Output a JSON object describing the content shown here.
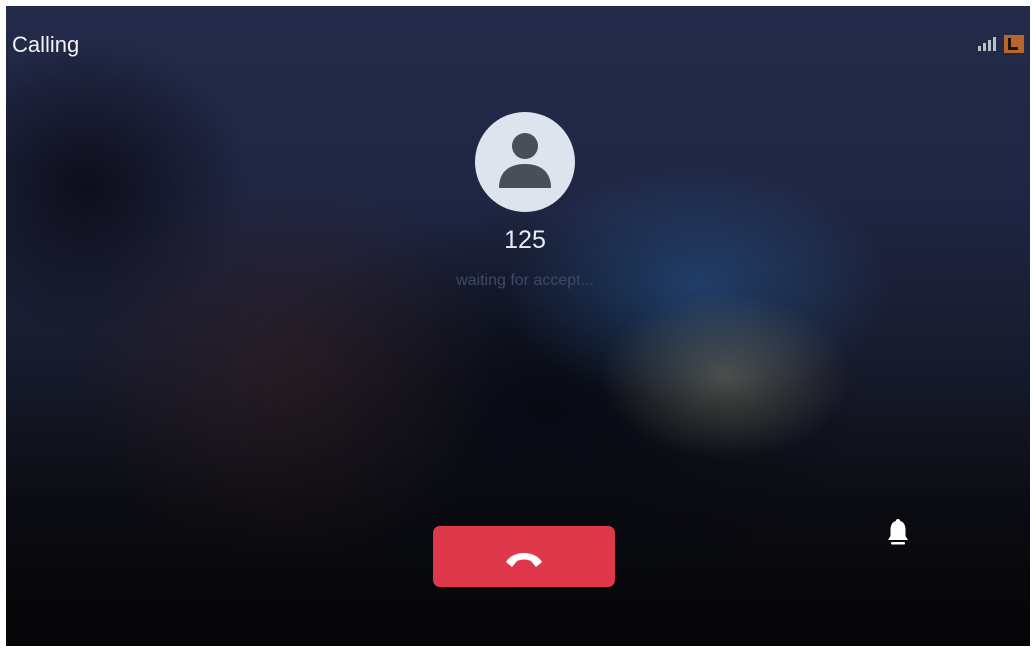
{
  "header": {
    "title": "Calling",
    "signal_icon": "signal-bars-icon",
    "line_icon": "line-status-icon"
  },
  "call": {
    "avatar_icon": "person-icon",
    "number": "125",
    "status_text": "waiting for accept..."
  },
  "controls": {
    "hangup_icon": "phone-hangup-icon",
    "bell_icon": "bell-icon"
  },
  "colors": {
    "hangup": "#e0384b",
    "avatar_bg": "#dde4ee",
    "avatar_fg": "#4a4e5a",
    "line_indicator": "#b8662a"
  }
}
